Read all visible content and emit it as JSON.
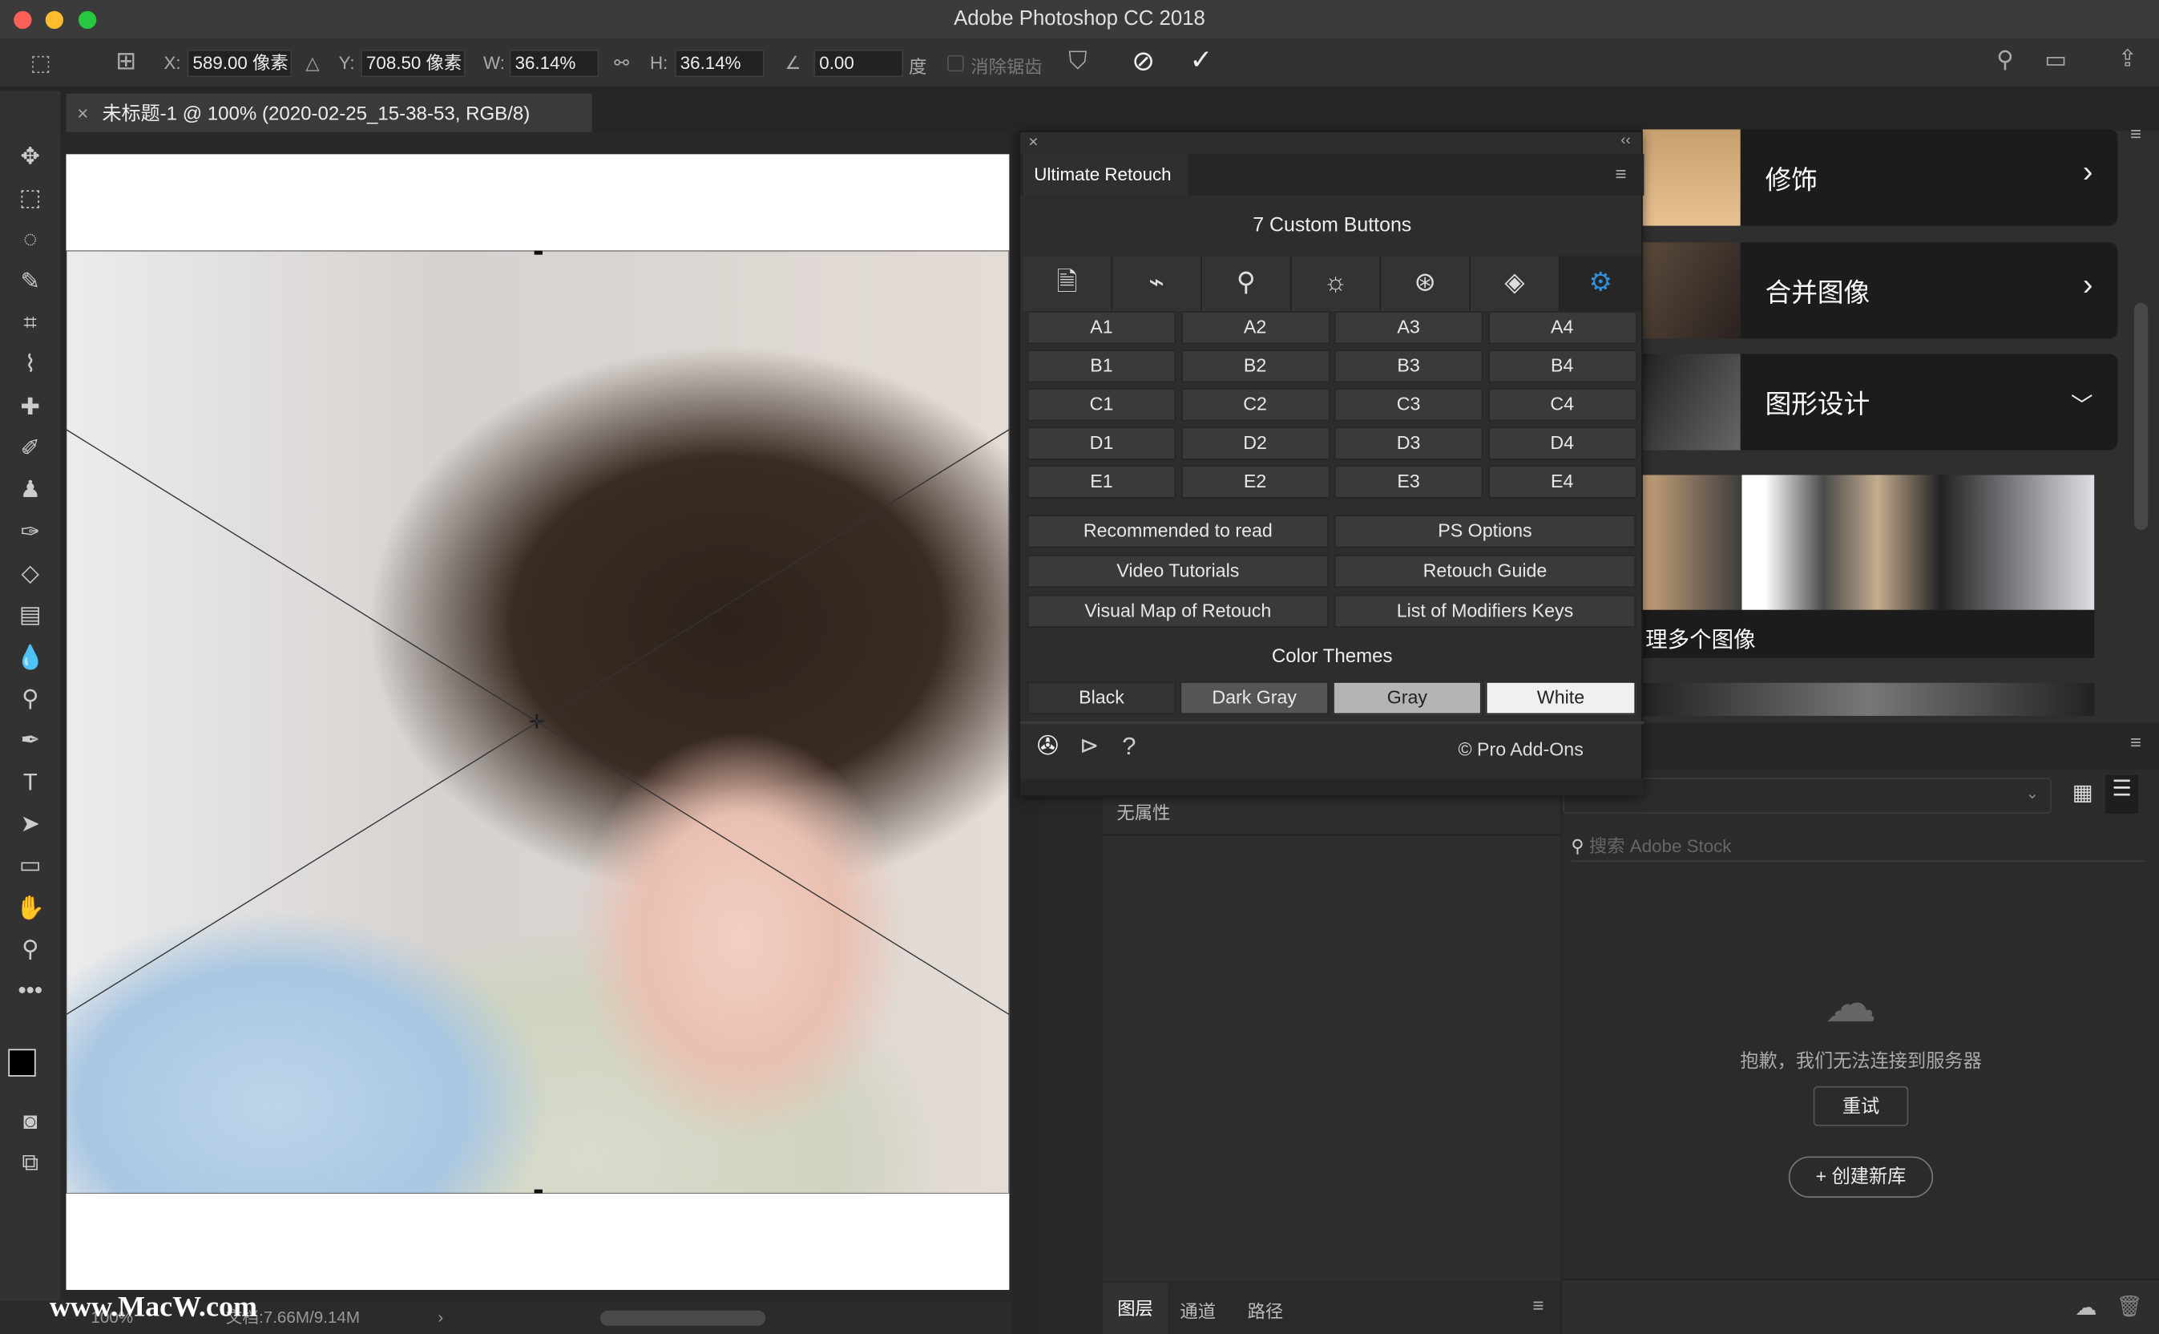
{
  "window": {
    "title": "Adobe Photoshop CC 2018"
  },
  "options": {
    "x_label": "X:",
    "x_value": "589.00 像素",
    "y_label": "Y:",
    "y_value": "708.50 像素",
    "w_label": "W:",
    "w_value": "36.14%",
    "h_label": "H:",
    "h_value": "36.14%",
    "angle_value": "0.00",
    "angle_unit": "度",
    "antialias_label": "消除锯齿"
  },
  "document": {
    "tab_title": "未标题-1 @ 100% (2020-02-25_15-38-53, RGB/8)",
    "zoom": "100%",
    "doc_size": "文档:7.66M/9.14M",
    "watermark": "www.MacW.com"
  },
  "plugin": {
    "title": "Ultimate Retouch",
    "subtitle": "7 Custom Buttons",
    "icons": [
      "document-icon",
      "pulse-icon",
      "search-icon",
      "brightness-icon",
      "color-circles-icon",
      "diamond-icon",
      "gear-icon"
    ],
    "grid": [
      [
        "A1",
        "A2",
        "A3",
        "A4"
      ],
      [
        "B1",
        "B2",
        "B3",
        "B4"
      ],
      [
        "C1",
        "C2",
        "C3",
        "C4"
      ],
      [
        "D1",
        "D2",
        "D3",
        "D4"
      ],
      [
        "E1",
        "E2",
        "E3",
        "E4"
      ]
    ],
    "links": [
      [
        "Recommended to read",
        "PS Options"
      ],
      [
        "Video Tutorials",
        "Retouch Guide"
      ],
      [
        "Visual Map of Retouch",
        "List of Modifiers Keys"
      ]
    ],
    "themes_label": "Color Themes",
    "themes": [
      "Black",
      "Dark Gray",
      "Gray",
      "White"
    ],
    "copyright": "© Pro Add-Ons",
    "help": "?",
    "accent": "#2f8fd8"
  },
  "learn": {
    "cards": [
      {
        "label": "修饰"
      },
      {
        "label": "合并图像"
      },
      {
        "label": "图形设计"
      }
    ],
    "subitem": "理多个图像"
  },
  "properties": {
    "empty": "无属性"
  },
  "libraries": {
    "search_placeholder": "搜索 Adobe Stock",
    "error": "抱歉，我们无法连接到服务器",
    "retry": "重试",
    "create": "+ 创建新库"
  },
  "layers": {
    "tabs": [
      "图层",
      "通道",
      "路径"
    ]
  }
}
